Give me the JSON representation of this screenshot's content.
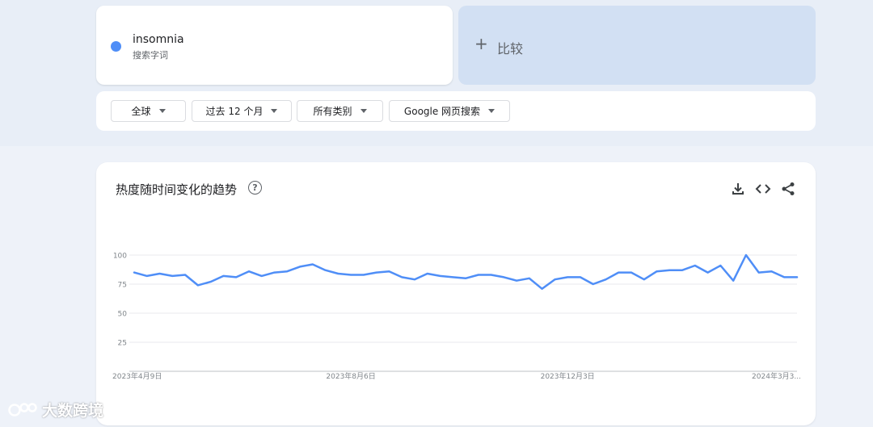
{
  "search_term": {
    "name": "insomnia",
    "type": "搜索字词",
    "color": "#4f8ef7"
  },
  "compare": {
    "plus": "+",
    "label": "比较"
  },
  "filters": [
    {
      "label": "全球"
    },
    {
      "label": "过去 12 个月"
    },
    {
      "label": "所有类别"
    },
    {
      "label": "Google 网页搜索"
    }
  ],
  "chart_header": {
    "title": "热度随时间变化的趋势",
    "help": "?"
  },
  "icons": {
    "download": "download-icon",
    "embed": "code-icon",
    "share": "share-icon",
    "help": "help-circle-icon"
  },
  "watermark": {
    "text": "大数跨境"
  },
  "chart_data": {
    "type": "line",
    "title": "热度随时间变化的趋势",
    "ylim": [
      0,
      100
    ],
    "yticks": [
      25,
      50,
      75,
      100
    ],
    "grid": true,
    "x_labels": [
      "2023年4月9日",
      "2023年8月6日",
      "2023年12月3日",
      "2024年3月3..."
    ],
    "x_label_index": [
      0,
      17,
      34,
      52
    ],
    "series": [
      {
        "color": "#4f8ef7",
        "values": [
          85,
          82,
          84,
          82,
          83,
          74,
          77,
          82,
          81,
          86,
          82,
          85,
          86,
          90,
          92,
          87,
          84,
          83,
          83,
          85,
          86,
          81,
          79,
          84,
          82,
          81,
          80,
          83,
          83,
          81,
          78,
          80,
          71,
          79,
          81,
          81,
          75,
          79,
          85,
          85,
          79,
          86,
          87,
          87,
          91,
          85,
          91,
          78,
          100,
          85,
          86,
          81,
          81
        ]
      }
    ]
  }
}
